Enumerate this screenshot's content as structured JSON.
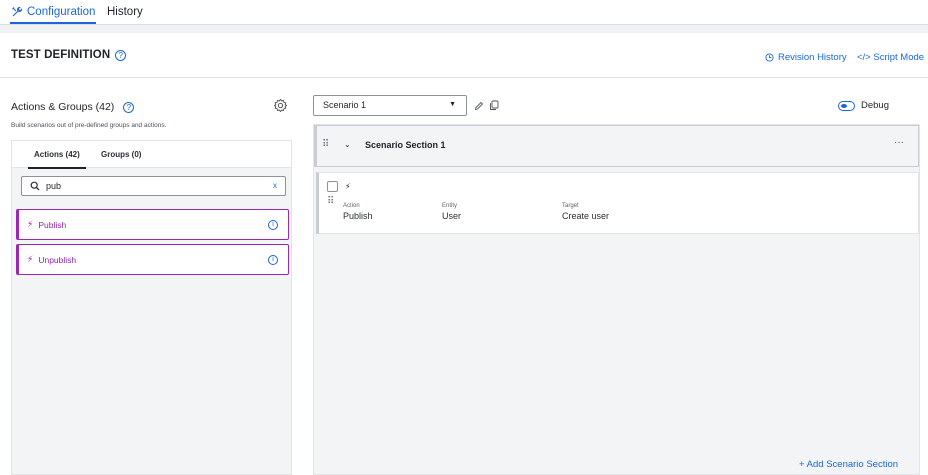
{
  "top_tabs": {
    "configuration": "Configuration",
    "history": "History"
  },
  "header": {
    "title": "TEST DEFINITION",
    "revision_history": "Revision History",
    "script_mode": "</> Script Mode"
  },
  "left": {
    "title": "Actions & Groups (42)",
    "subtitle": "Build scenarios out of pre-defined groups and actions.",
    "tabs": {
      "actions": "Actions (42)",
      "groups": "Groups (0)"
    },
    "search": {
      "value": "pub",
      "clear": "x"
    },
    "items": [
      {
        "label": "Publish"
      },
      {
        "label": "Unpublish"
      }
    ]
  },
  "scenario": {
    "selected": "Scenario 1",
    "debug_label": "Debug"
  },
  "section": {
    "title": "Scenario Section 1",
    "more": "···",
    "step": {
      "columns": {
        "action": {
          "label": "Action",
          "value": "Publish"
        },
        "entity": {
          "label": "Entity",
          "value": "User"
        },
        "target": {
          "label": "Target",
          "value": "Create user"
        }
      }
    }
  },
  "add_section": "+ Add Scenario Section",
  "colors": {
    "accent": "#1a66d8",
    "action_purple": "#9c27b0"
  }
}
